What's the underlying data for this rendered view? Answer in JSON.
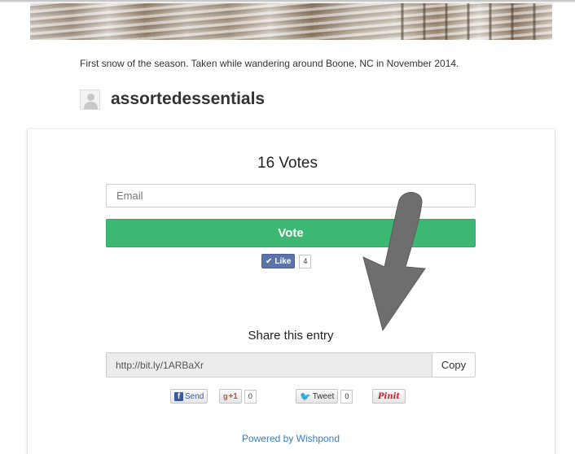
{
  "caption": "First snow of the season. Taken while wandering around Boone, NC in November 2014.",
  "author": {
    "name": "assortedessentials"
  },
  "voting": {
    "votes_label": "16 Votes",
    "email_placeholder": "Email",
    "vote_button": "Vote"
  },
  "facebook_like": {
    "label": "Like",
    "count": "4"
  },
  "share": {
    "title": "Share this entry",
    "url": "http://bit.ly/1ARBaXr",
    "copy_label": "Copy"
  },
  "social": {
    "send_label": "Send",
    "gplus_label": "+1",
    "gplus_count": "0",
    "tweet_label": "Tweet",
    "tweet_count": "0",
    "pin_label": "Pinit"
  },
  "footer": {
    "prefix": "Powered by",
    "brand": "Wishpond"
  },
  "colors": {
    "vote_green": "#3db774",
    "link_blue": "#3a7dbf",
    "arrow_gray": "#6e6e6e"
  }
}
